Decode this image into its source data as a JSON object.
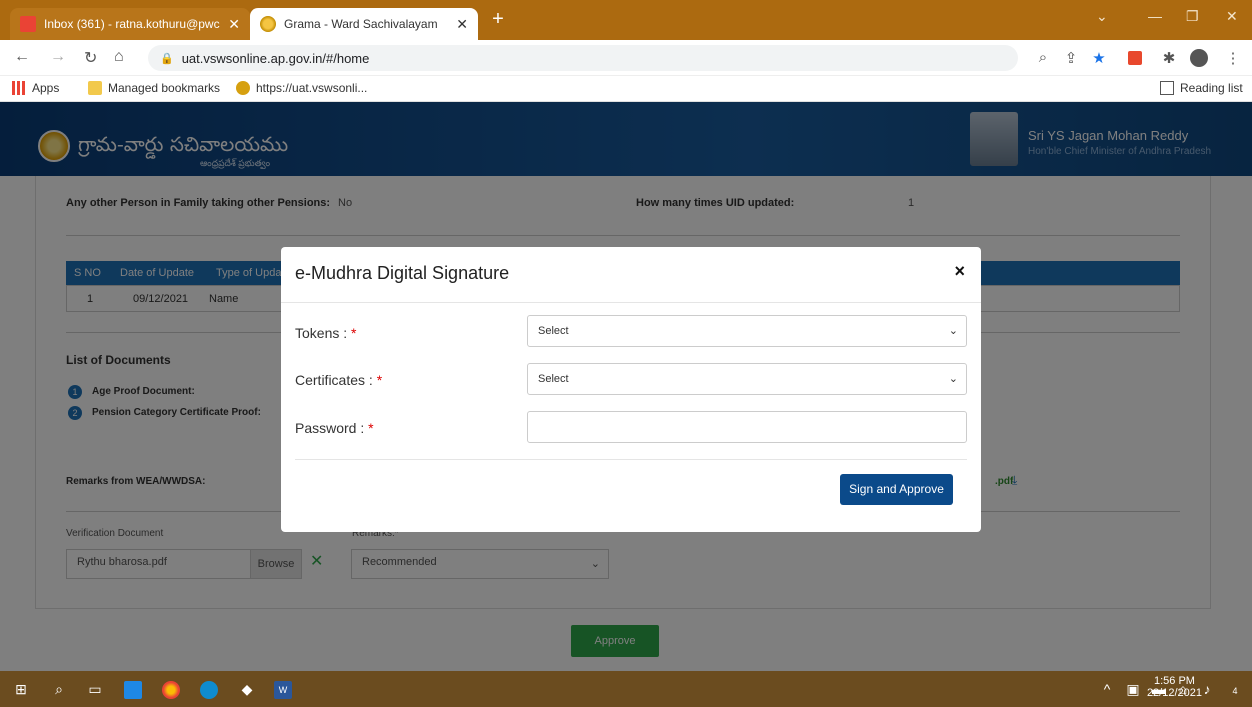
{
  "browser": {
    "tabs": [
      {
        "title": "Inbox (361) - ratna.kothuru@pwc"
      },
      {
        "title": "Grama - Ward Sachivalayam"
      }
    ],
    "url": "uat.vswsonline.ap.gov.in/#/home",
    "bookmarks": [
      {
        "label": "Apps"
      },
      {
        "label": "Managed bookmarks"
      },
      {
        "label": "https://uat.vswsonli..."
      }
    ],
    "reading_list": "Reading list"
  },
  "header": {
    "brand": "గ్రామ-వార్డు సచివాలయము",
    "brand_sub": "ఆంధ్రప్రదేశ్ ప్రభుత్వం",
    "cm_name": "Sri YS Jagan Mohan Reddy",
    "cm_title": "Hon'ble Chief Minister of Andhra Pradesh"
  },
  "details": {
    "other_pension_label": "Any other Person in Family taking other Pensions:",
    "other_pension_value": "No",
    "uid_updated_label": "How many times UID updated:",
    "uid_updated_value": "1"
  },
  "update_table": {
    "headers": [
      "S NO",
      "Date of Update",
      "Type of Update"
    ],
    "row": [
      "1",
      "09/12/2021",
      "Name"
    ]
  },
  "documents": {
    "heading": "List of Documents",
    "items": [
      {
        "num": "1",
        "label": "Age Proof Document:"
      },
      {
        "num": "2",
        "label": "Pension Category Certificate Proof:"
      }
    ]
  },
  "remarks": {
    "label": "Remarks from WEA/WWDSA:",
    "pdf_suffix": ".pdf"
  },
  "verification": {
    "label": "Verification Document",
    "file": "Rythu bharosa.pdf",
    "browse": "Browse",
    "remarks_label": "Remarks:*",
    "remarks_value": "Recommended"
  },
  "approve_label": "Approve",
  "modal": {
    "title": "e-Mudhra Digital Signature",
    "close": "×",
    "tokens_label": "Tokens : ",
    "tokens_value": "Select",
    "certificates_label": "Certificates : ",
    "certificates_value": "Select",
    "password_label": "Password : ",
    "required": "*",
    "button": "Sign and Approve"
  },
  "taskbar": {
    "time": "1:56 PM",
    "date": "22/12/2021",
    "notif": "4"
  }
}
